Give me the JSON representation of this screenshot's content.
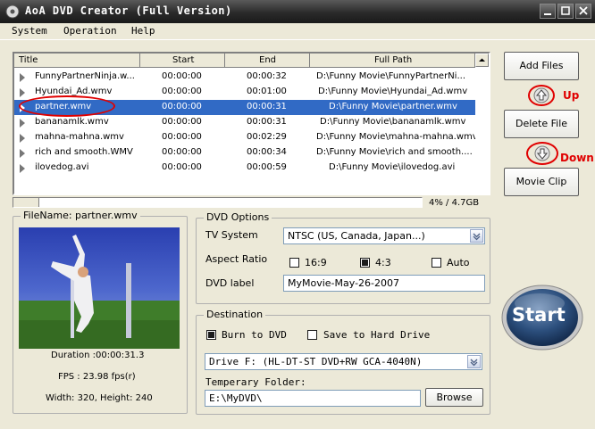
{
  "window": {
    "title": "AoA DVD Creator (Full Version)"
  },
  "menu": [
    "System",
    "Operation",
    "Help"
  ],
  "columns": [
    "Title",
    "Start",
    "End",
    "Full Path"
  ],
  "files": [
    {
      "title": "FunnyPartnerNinja.w...",
      "start": "00:00:00",
      "end": "00:00:32",
      "path": "D:\\Funny Movie\\FunnyPartnerNi..."
    },
    {
      "title": "Hyundai_Ad.wmv",
      "start": "00:00:00",
      "end": "00:01:00",
      "path": "D:\\Funny Movie\\Hyundai_Ad.wmv"
    },
    {
      "title": "partner.wmv",
      "start": "00:00:00",
      "end": "00:00:31",
      "path": "D:\\Funny Movie\\partner.wmv"
    },
    {
      "title": "bananamlk.wmv",
      "start": "00:00:00",
      "end": "00:00:31",
      "path": "D:\\Funny Movie\\bananamlk.wmv"
    },
    {
      "title": "mahna-mahna.wmv",
      "start": "00:00:00",
      "end": "00:02:29",
      "path": "D:\\Funny Movie\\mahna-mahna.wmv"
    },
    {
      "title": "rich and smooth.WMV",
      "start": "00:00:00",
      "end": "00:00:34",
      "path": "D:\\Funny Movie\\rich and smooth...."
    },
    {
      "title": "ilovedog.avi",
      "start": "00:00:00",
      "end": "00:00:59",
      "path": "D:\\Funny Movie\\ilovedog.avi"
    }
  ],
  "selected_index": 2,
  "disc_usage": {
    "text": "4% / 4.7GB",
    "fraction": 0.04
  },
  "buttons": {
    "add_files": "Add Files",
    "delete_file": "Delete File",
    "movie_clip": "Movie Clip",
    "start": "Start",
    "browse": "Browse"
  },
  "annotations": {
    "up": "Up",
    "down": "Down"
  },
  "preview": {
    "filename_label": "FileName:  partner.wmv",
    "duration": "Duration :00:00:31.3",
    "fps": "FPS : 23.98 fps(r)",
    "size": "Width: 320, Height: 240"
  },
  "dvd_options": {
    "title": "DVD Options",
    "tv_system_label": "TV System",
    "tv_system_value": "NTSC (US, Canada, Japan...)",
    "aspect_label": "Aspect Ratio",
    "aspect_options": [
      "16:9",
      "4:3",
      "Auto"
    ],
    "aspect_selected": "4:3",
    "label_label": "DVD label",
    "label_value": "MyMovie-May-26-2007"
  },
  "destination": {
    "title": "Destination",
    "burn_label": "Burn to DVD",
    "burn_checked": true,
    "save_label": "Save to Hard Drive",
    "save_checked": false,
    "drive_value": "Drive F:  (HL-DT-ST DVD+RW GCA-4040N)",
    "temp_label": "Temperary Folder:",
    "temp_value": "E:\\MyDVD\\"
  },
  "colors": {
    "selection": "#316ac5",
    "annotation": "#e00000",
    "start_button": "#1e3f6a"
  },
  "icons": {
    "up": "up-arrow-icon",
    "down": "down-arrow-icon",
    "dropdown": "chevron-down-icon"
  }
}
